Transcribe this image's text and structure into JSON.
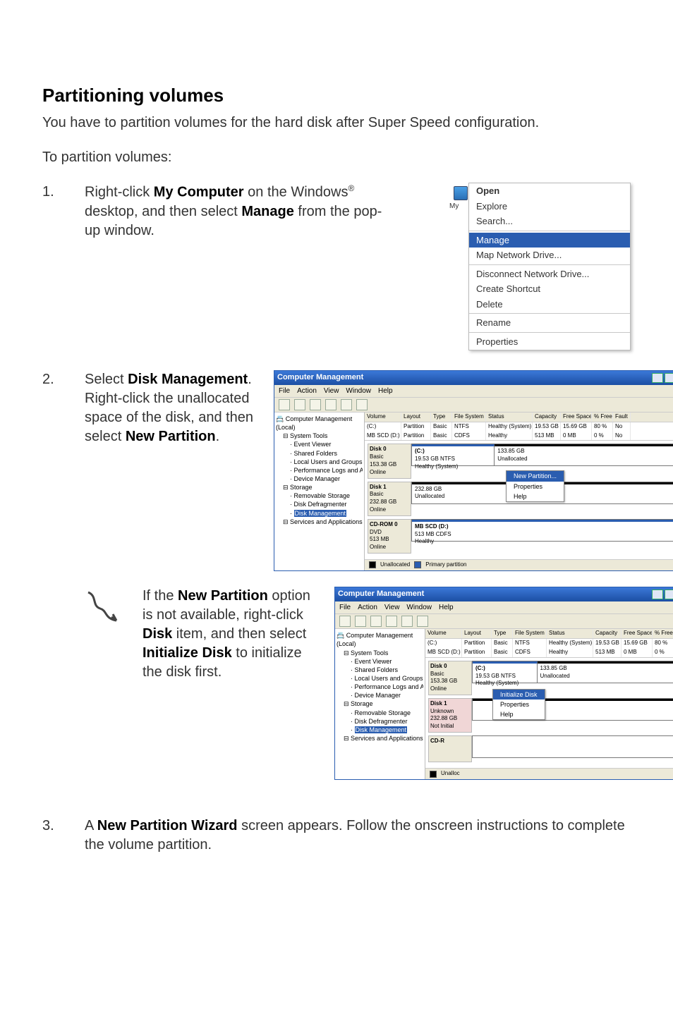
{
  "heading": "Partitioning volumes",
  "intro": "You have to partition volumes for the hard disk after Super Speed configuration.",
  "sub": "To partition volumes:",
  "steps": {
    "s1": {
      "num": "1.",
      "text_pre": "Right-click ",
      "bold1": "My Computer",
      "text_mid": " on the Windows",
      "reg": "®",
      "text_mid2": " desktop, and then select ",
      "bold2": "Manage",
      "text_end": " from the pop-up window."
    },
    "s2": {
      "num": "2.",
      "text_pre": "Select ",
      "bold1": "Disk Management",
      "text_mid": ". Right-click the unallocated space of the disk, and then select ",
      "bold2": "New Partition",
      "text_end": "."
    },
    "note": {
      "text_pre": "If the ",
      "bold1": "New Partition",
      "text_mid": " option is not available, right-click ",
      "bold2": "Disk",
      "text_mid2": " item, and then select ",
      "bold3": "Initialize Disk",
      "text_end": " to initialize the disk first."
    },
    "s3": {
      "num": "3.",
      "text_pre": "A ",
      "bold1": "New Partition Wizard",
      "text_end": " screen appears. Follow the onscreen instructions to complete the volume partition."
    }
  },
  "context_menu": {
    "my_label": "My",
    "items": [
      "Open",
      "Explore",
      "Search...",
      "Manage",
      "Map Network Drive...",
      "Disconnect Network Drive...",
      "Create Shortcut",
      "Delete",
      "Rename",
      "Properties"
    ],
    "highlight": "Manage",
    "bold": "Open"
  },
  "cm_window": {
    "title": "Computer Management",
    "menu": [
      "File",
      "Action",
      "View",
      "Window",
      "Help"
    ],
    "tree": {
      "root": "Computer Management (Local)",
      "groups": [
        {
          "label": "System Tools",
          "children": [
            "Event Viewer",
            "Shared Folders",
            "Local Users and Groups",
            "Performance Logs and Alerts",
            "Device Manager"
          ]
        },
        {
          "label": "Storage",
          "children": [
            "Removable Storage",
            "Disk Defragmenter",
            "Disk Management"
          ]
        },
        {
          "label": "Services and Applications",
          "children": []
        }
      ]
    },
    "vol_headers": [
      "Volume",
      "Layout",
      "Type",
      "File System",
      "Status",
      "Capacity",
      "Free Space",
      "% Free",
      "Fault"
    ],
    "vol_rows": [
      {
        "v": "(C:)",
        "l": "Partition",
        "t": "Basic",
        "fs": "NTFS",
        "s": "Healthy (System)",
        "c": "19.53 GB",
        "f": "15.69 GB",
        "p": "80 %",
        "ft": "No"
      },
      {
        "v": "MB SCD (D:)",
        "l": "Partition",
        "t": "Basic",
        "fs": "CDFS",
        "s": "Healthy",
        "c": "513 MB",
        "f": "0 MB",
        "p": "0 %",
        "ft": "No"
      }
    ],
    "disks": [
      {
        "hdr": "Disk 0",
        "line2": "Basic",
        "line3": "153.38 GB",
        "line4": "Online",
        "segs": [
          {
            "t1": "(C:)",
            "t2": "19.53 GB NTFS",
            "t3": "Healthy (System)",
            "w": "30%",
            "cls": "blue"
          },
          {
            "t1": "",
            "t2": "133.85 GB",
            "t3": "Unallocated",
            "w": "70%",
            "cls": "black"
          }
        ]
      },
      {
        "hdr": "Disk 1",
        "line2": "Basic",
        "line3": "232.88 GB",
        "line4": "Online",
        "segs": [
          {
            "t1": "",
            "t2": "232.88 GB",
            "t3": "Unallocated",
            "w": "100%",
            "cls": "black"
          }
        ]
      },
      {
        "hdr": "CD-ROM 0",
        "line2": "DVD",
        "line3": "513 MB",
        "line4": "Online",
        "segs": [
          {
            "t1": "MB SCD (D:)",
            "t2": "513 MB CDFS",
            "t3": "Healthy",
            "w": "100%",
            "cls": "blue"
          }
        ]
      }
    ],
    "ctx1": [
      "New Partition...",
      "Properties",
      "Help"
    ],
    "ctx1_hl": "New Partition...",
    "legend": [
      "Unallocated",
      "Primary partition"
    ]
  },
  "cm_window2": {
    "disks": [
      {
        "hdr": "Disk 0",
        "line2": "Basic",
        "line3": "153.38 GB",
        "line4": "Online",
        "segs": [
          {
            "t1": "(C:)",
            "t2": "19.53 GB NTFS",
            "t3": "Healthy (System)",
            "w": "30%",
            "cls": "blue"
          },
          {
            "t1": "",
            "t2": "133.85 GB",
            "t3": "Unallocated",
            "w": "70%",
            "cls": "black"
          }
        ]
      },
      {
        "hdr": "Disk 1",
        "line2": "Unknown",
        "line3": "232.88 GB",
        "line4": "Not Initial",
        "unk": true,
        "segs": [
          {
            "t1": "",
            "t2": "",
            "t3": "",
            "w": "100%",
            "cls": "black"
          }
        ]
      },
      {
        "hdr": "CD-R",
        "line2": "",
        "line3": "",
        "line4": "",
        "segs": []
      }
    ],
    "ctx2": [
      "Initialize Disk",
      "Properties",
      "Help"
    ],
    "ctx2_hl": "Initialize Disk",
    "legend": "Unalloc"
  }
}
